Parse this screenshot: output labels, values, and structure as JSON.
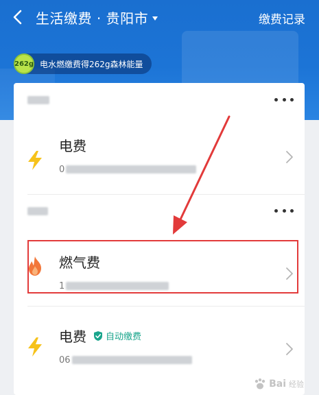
{
  "header": {
    "title": "生活缴费 · 贵阳市",
    "records_label": "缴费记录",
    "energy": {
      "badge": "262g",
      "text": "电水燃缴费得262g森林能量"
    }
  },
  "groups": [
    {
      "name": "",
      "bills": [
        {
          "name": "电费",
          "account": "0",
          "icon": "lightning-icon"
        }
      ]
    },
    {
      "name": "",
      "bills": [
        {
          "name": "燃气费",
          "account": "1",
          "icon": "flame-icon"
        },
        {
          "name": "电费",
          "account": "06",
          "icon": "lightning-icon",
          "auto_pay": "自动缴费"
        }
      ]
    }
  ],
  "watermark": {
    "text": "Bai",
    "suffix": "经验"
  },
  "colors": {
    "header_blue": "#1c74d6",
    "lightning": "#f6c21b",
    "flame": "#f2773a",
    "auto_pay": "#1aa58c",
    "highlight": "#e23a3a"
  }
}
